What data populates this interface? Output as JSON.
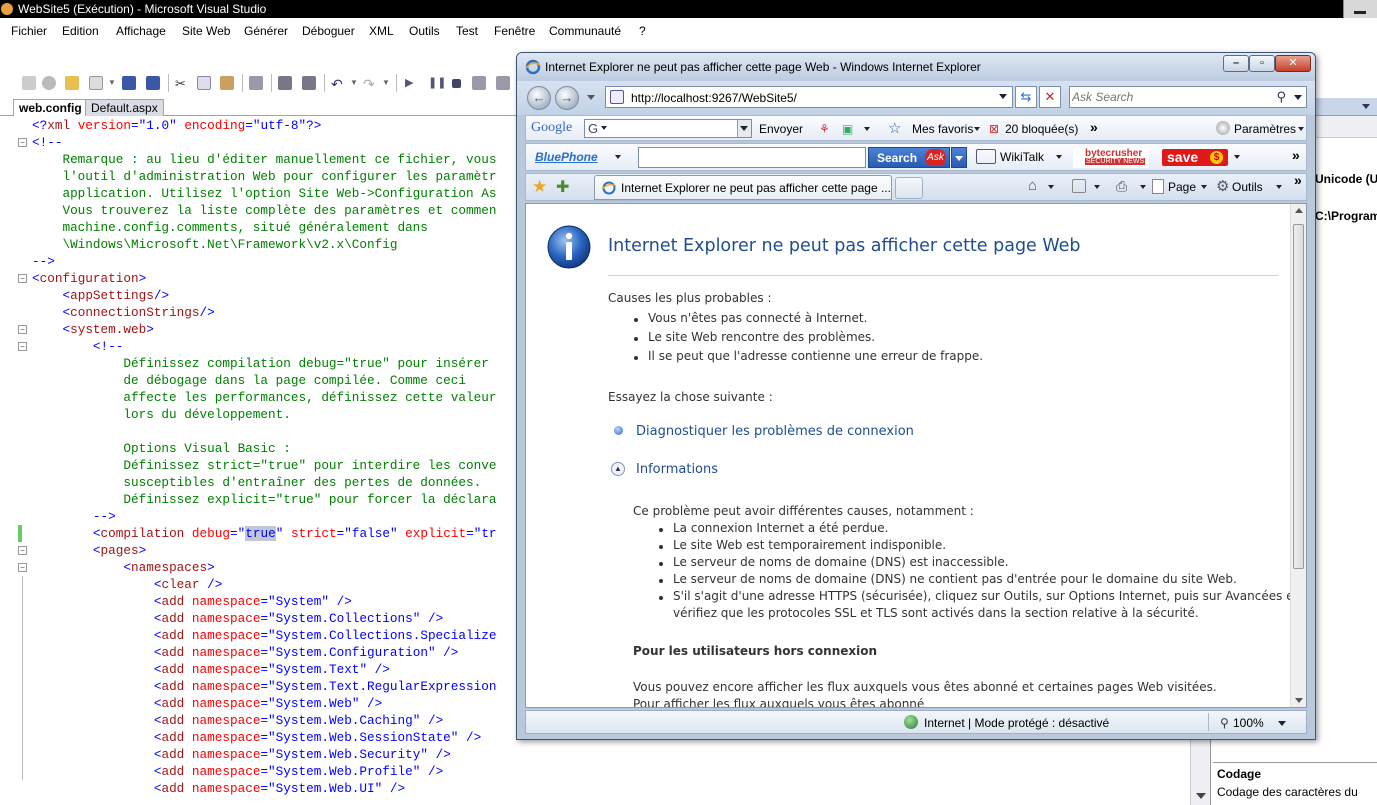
{
  "vs": {
    "title": "WebSite5 (Exécution) - Microsoft Visual Studio",
    "menu": [
      "Fichier",
      "Edition",
      "Affichage",
      "Site Web",
      "Générer",
      "Déboguer",
      "XML",
      "Outils",
      "Test",
      "Fenêtre",
      "Communauté",
      "?"
    ],
    "tabs": [
      "web.config",
      "Default.aspx"
    ],
    "code": [
      [
        [
          "blue",
          "<?"
        ],
        [
          "maroon",
          "xml"
        ],
        [
          "red",
          " version"
        ],
        [
          "blue",
          "=\""
        ],
        [
          "blue",
          "1.0"
        ],
        [
          "blue",
          "\""
        ],
        [
          "red",
          " encoding"
        ],
        [
          "blue",
          "=\""
        ],
        [
          "blue",
          "utf-8"
        ],
        [
          "blue",
          "\"?>"
        ]
      ],
      [
        [
          "blue",
          "<!--"
        ]
      ],
      [
        [
          "green",
          "    Remarque : au lieu d'éditer manuellement ce fichier, vous"
        ]
      ],
      [
        [
          "green",
          "    l'outil d'administration Web pour configurer les paramètr"
        ]
      ],
      [
        [
          "green",
          "    application. Utilisez l'option Site Web->Configuration As"
        ]
      ],
      [
        [
          "green",
          "    Vous trouverez la liste complète des paramètres et commen"
        ]
      ],
      [
        [
          "green",
          "    machine.config.comments, situé généralement dans"
        ]
      ],
      [
        [
          "green",
          "    \\Windows\\Microsoft.Net\\Framework\\v2.x\\Config"
        ]
      ],
      [
        [
          "blue",
          "-->"
        ]
      ],
      [
        [
          "blue",
          "<"
        ],
        [
          "maroon",
          "configuration"
        ],
        [
          "blue",
          ">"
        ]
      ],
      [
        [
          "plain",
          "    "
        ],
        [
          "blue",
          "<"
        ],
        [
          "maroon",
          "appSettings"
        ],
        [
          "blue",
          "/>"
        ]
      ],
      [
        [
          "plain",
          "    "
        ],
        [
          "blue",
          "<"
        ],
        [
          "maroon",
          "connectionStrings"
        ],
        [
          "blue",
          "/>"
        ]
      ],
      [
        [
          "plain",
          "    "
        ],
        [
          "blue",
          "<"
        ],
        [
          "maroon",
          "system.web"
        ],
        [
          "blue",
          ">"
        ]
      ],
      [
        [
          "plain",
          "        "
        ],
        [
          "blue",
          "<!--"
        ]
      ],
      [
        [
          "green",
          "            Définissez compilation debug=\"true\" pour insérer"
        ]
      ],
      [
        [
          "green",
          "            de débogage dans la page compilée. Comme ceci"
        ]
      ],
      [
        [
          "green",
          "            affecte les performances, définissez cette valeur"
        ]
      ],
      [
        [
          "green",
          "            lors du développement."
        ]
      ],
      [
        [
          "green",
          ""
        ]
      ],
      [
        [
          "green",
          "            Options Visual Basic :"
        ]
      ],
      [
        [
          "green",
          "            Définissez strict=\"true\" pour interdire les conve"
        ]
      ],
      [
        [
          "green",
          "            susceptibles d'entraîner des pertes de données."
        ]
      ],
      [
        [
          "green",
          "            Définissez explicit=\"true\" pour forcer la déclara"
        ]
      ],
      [
        [
          "plain",
          "        "
        ],
        [
          "blue",
          "-->"
        ]
      ],
      [
        [
          "plain",
          "        "
        ],
        [
          "blue",
          "<"
        ],
        [
          "maroon",
          "compilation"
        ],
        [
          "red",
          " debug"
        ],
        [
          "blue",
          "=\""
        ],
        [
          "sel",
          "true"
        ],
        [
          "blue",
          "\""
        ],
        [
          "red",
          " strict"
        ],
        [
          "blue",
          "=\""
        ],
        [
          "blue",
          "false"
        ],
        [
          "blue",
          "\""
        ],
        [
          "red",
          " explicit"
        ],
        [
          "blue",
          "=\"tr"
        ]
      ],
      [
        [
          "plain",
          "        "
        ],
        [
          "blue",
          "<"
        ],
        [
          "maroon",
          "pages"
        ],
        [
          "blue",
          ">"
        ]
      ],
      [
        [
          "plain",
          "            "
        ],
        [
          "blue",
          "<"
        ],
        [
          "maroon",
          "namespaces"
        ],
        [
          "blue",
          ">"
        ]
      ],
      [
        [
          "plain",
          "                "
        ],
        [
          "blue",
          "<"
        ],
        [
          "maroon",
          "clear"
        ],
        [
          "blue",
          " />"
        ]
      ],
      [
        [
          "plain",
          "                "
        ],
        [
          "blue",
          "<"
        ],
        [
          "maroon",
          "add"
        ],
        [
          "red",
          " namespace"
        ],
        [
          "blue",
          "=\""
        ],
        [
          "blue",
          "System"
        ],
        [
          "blue",
          "\" />"
        ]
      ],
      [
        [
          "plain",
          "                "
        ],
        [
          "blue",
          "<"
        ],
        [
          "maroon",
          "add"
        ],
        [
          "red",
          " namespace"
        ],
        [
          "blue",
          "=\""
        ],
        [
          "blue",
          "System.Collections"
        ],
        [
          "blue",
          "\" />"
        ]
      ],
      [
        [
          "plain",
          "                "
        ],
        [
          "blue",
          "<"
        ],
        [
          "maroon",
          "add"
        ],
        [
          "red",
          " namespace"
        ],
        [
          "blue",
          "=\""
        ],
        [
          "blue",
          "System.Collections.Specialize"
        ]
      ],
      [
        [
          "plain",
          "                "
        ],
        [
          "blue",
          "<"
        ],
        [
          "maroon",
          "add"
        ],
        [
          "red",
          " namespace"
        ],
        [
          "blue",
          "=\""
        ],
        [
          "blue",
          "System.Configuration"
        ],
        [
          "blue",
          "\" />"
        ]
      ],
      [
        [
          "plain",
          "                "
        ],
        [
          "blue",
          "<"
        ],
        [
          "maroon",
          "add"
        ],
        [
          "red",
          " namespace"
        ],
        [
          "blue",
          "=\""
        ],
        [
          "blue",
          "System.Text"
        ],
        [
          "blue",
          "\" />"
        ]
      ],
      [
        [
          "plain",
          "                "
        ],
        [
          "blue",
          "<"
        ],
        [
          "maroon",
          "add"
        ],
        [
          "red",
          " namespace"
        ],
        [
          "blue",
          "=\""
        ],
        [
          "blue",
          "System.Text.RegularExpression"
        ]
      ],
      [
        [
          "plain",
          "                "
        ],
        [
          "blue",
          "<"
        ],
        [
          "maroon",
          "add"
        ],
        [
          "red",
          " namespace"
        ],
        [
          "blue",
          "=\""
        ],
        [
          "blue",
          "System.Web"
        ],
        [
          "blue",
          "\" />"
        ]
      ],
      [
        [
          "plain",
          "                "
        ],
        [
          "blue",
          "<"
        ],
        [
          "maroon",
          "add"
        ],
        [
          "red",
          " namespace"
        ],
        [
          "blue",
          "=\""
        ],
        [
          "blue",
          "System.Web.Caching"
        ],
        [
          "blue",
          "\" />"
        ]
      ],
      [
        [
          "plain",
          "                "
        ],
        [
          "blue",
          "<"
        ],
        [
          "maroon",
          "add"
        ],
        [
          "red",
          " namespace"
        ],
        [
          "blue",
          "=\""
        ],
        [
          "blue",
          "System.Web.SessionState"
        ],
        [
          "blue",
          "\" />"
        ]
      ],
      [
        [
          "plain",
          "                "
        ],
        [
          "blue",
          "<"
        ],
        [
          "maroon",
          "add"
        ],
        [
          "red",
          " namespace"
        ],
        [
          "blue",
          "=\""
        ],
        [
          "blue",
          "System.Web.Security"
        ],
        [
          "blue",
          "\" />"
        ]
      ],
      [
        [
          "plain",
          "                "
        ],
        [
          "blue",
          "<"
        ],
        [
          "maroon",
          "add"
        ],
        [
          "red",
          " namespace"
        ],
        [
          "blue",
          "=\""
        ],
        [
          "blue",
          "System.Web.Profile"
        ],
        [
          "blue",
          "\" />"
        ]
      ],
      [
        [
          "plain",
          "                "
        ],
        [
          "blue",
          "<"
        ],
        [
          "maroon",
          "add"
        ],
        [
          "red",
          " namespace"
        ],
        [
          "blue",
          "=\""
        ],
        [
          "blue",
          "System.Web.UI"
        ],
        [
          "blue",
          "\" />"
        ]
      ]
    ],
    "properties": {
      "row1": "Unicode (UT",
      "row2": "C:\\Program",
      "desc_title": "Codage",
      "desc_text": "Codage des caractères du"
    }
  },
  "ie": {
    "title": "Internet Explorer ne peut pas afficher cette page Web - Windows Internet Explorer",
    "address": "http://localhost:9267/WebSite5/",
    "search_placeholder": "Ask Search",
    "toolbar1": {
      "google": "Google",
      "google_box": "G",
      "envoyer": "Envoyer",
      "favoris": "Mes favoris",
      "blocked": "20 bloquée(s)",
      "more": "»",
      "params": "Paramètres"
    },
    "toolbar2": {
      "bluephone": "BluePhone",
      "search_btn": "Search",
      "ask": "Ask",
      "wikitalk": "WikiTalk",
      "bytecrusher": "bytecrusher",
      "security_news": "SECURITY NEWS",
      "save": "save",
      "save_symbol": "$",
      "more": "»"
    },
    "tab_label": "Internet Explorer ne peut pas afficher cette page ...",
    "cmd": {
      "page": "Page",
      "outils": "Outils",
      "more": "»"
    },
    "content": {
      "heading": "Internet Explorer ne peut pas afficher cette page Web",
      "causes_title": "Causes les plus probables :",
      "causes": [
        "Vous n'êtes pas connecté à Internet.",
        "Le site Web rencontre des problèmes.",
        "Il se peut que l'adresse contienne une erreur de frappe."
      ],
      "try_title": "Essayez la chose suivante :",
      "diagnose_link": "Diagnostiquer les problèmes de connexion",
      "info_link": "Informations",
      "info_intro": "Ce problème peut avoir différentes causes, notamment :",
      "info_items": [
        "La connexion Internet a été perdue.",
        "Le site Web est temporairement indisponible.",
        "Le serveur de noms de domaine (DNS) est inaccessible.",
        "Le serveur de noms de domaine (DNS) ne contient pas d'entrée pour le domaine du site Web.",
        "S'il s'agit d'une adresse HTTPS (sécurisée), cliquez sur Outils, sur Options Internet, puis sur Avancées et",
        "vérifiez que les protocoles SSL et TLS sont activés dans la section relative à la sécurité."
      ],
      "offline_title": "Pour les utilisateurs hors connexion",
      "offline_text": "Vous pouvez encore afficher les flux auxquels vous êtes abonné et certaines pages Web visitées.",
      "offline_text2": "Pour afficher les flux auxquels vous êtes abonné"
    },
    "status": {
      "zone": "Internet | Mode protégé : désactivé",
      "zoom": "100%"
    }
  }
}
